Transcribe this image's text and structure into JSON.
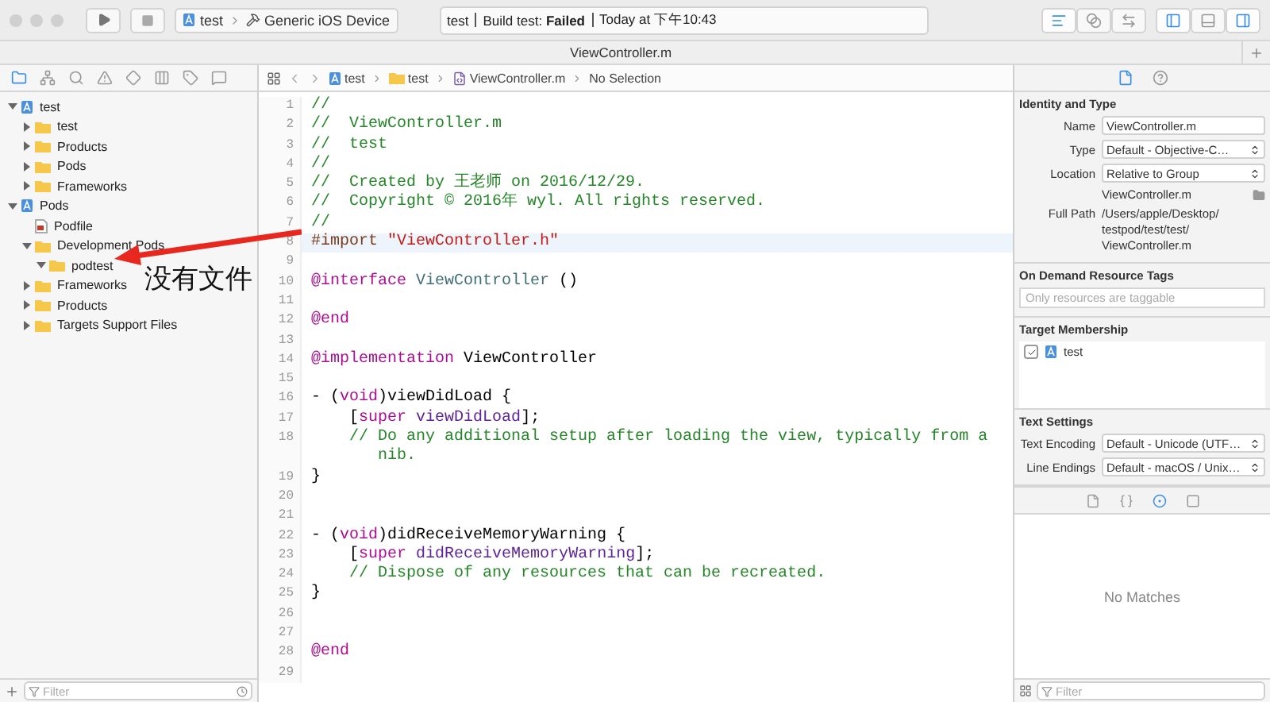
{
  "toolbar": {
    "scheme": {
      "project": "test",
      "device": "Generic iOS Device"
    },
    "status": {
      "project": "test",
      "message": "Build test: **Failed**",
      "time": "Today at 下午10:43"
    },
    "editor_modes": [
      {
        "kind": "standard",
        "selected": true
      },
      {
        "kind": "assistant",
        "selected": false
      },
      {
        "kind": "version",
        "selected": false
      }
    ],
    "panels": [
      {
        "kind": "left",
        "on": true
      },
      {
        "kind": "bottom",
        "on": false
      },
      {
        "kind": "right",
        "on": true
      }
    ]
  },
  "tab_bar": {
    "title": "ViewController.m"
  },
  "navigator": {
    "tabs": [
      {
        "kind": "project",
        "selected": true
      },
      {
        "kind": "symbol",
        "selected": false
      },
      {
        "kind": "find",
        "selected": false
      },
      {
        "kind": "issue",
        "selected": false
      },
      {
        "kind": "test",
        "selected": false
      },
      {
        "kind": "debug",
        "selected": false
      },
      {
        "kind": "breakpoint",
        "selected": false
      },
      {
        "kind": "report",
        "selected": false
      }
    ],
    "tree": [
      {
        "label": "test",
        "kind": "project",
        "expanded": true,
        "children": [
          {
            "label": "test",
            "kind": "folder",
            "expanded": false
          },
          {
            "label": "Products",
            "kind": "folder",
            "expanded": false
          },
          {
            "label": "Pods",
            "kind": "folder",
            "expanded": false
          },
          {
            "label": "Frameworks",
            "kind": "folder",
            "expanded": false
          }
        ]
      },
      {
        "label": "Pods",
        "kind": "project",
        "expanded": true,
        "children": [
          {
            "label": "Podfile",
            "kind": "file"
          },
          {
            "label": "Development Pods",
            "kind": "folder",
            "expanded": true,
            "children": [
              {
                "label": "podtest",
                "kind": "folder",
                "expanded": true
              }
            ]
          },
          {
            "label": "Frameworks",
            "kind": "folder",
            "expanded": false
          },
          {
            "label": "Products",
            "kind": "folder",
            "expanded": false
          },
          {
            "label": "Targets Support Files",
            "kind": "folder",
            "expanded": false
          }
        ]
      }
    ],
    "filter": {
      "placeholder": "Filter"
    }
  },
  "editor": {
    "jump_bar": [
      {
        "kind": "project",
        "label": "test"
      },
      {
        "kind": "folder",
        "label": "test"
      },
      {
        "kind": "file",
        "label": "ViewController.m"
      },
      {
        "kind": "text",
        "label": "No Selection"
      }
    ],
    "lines": [
      {
        "number": "1",
        "current": false,
        "tokens": [
          {
            "kind": "comment",
            "text": "//"
          }
        ]
      },
      {
        "number": "2",
        "current": false,
        "tokens": [
          {
            "kind": "comment",
            "text": "//  ViewController.m"
          }
        ]
      },
      {
        "number": "3",
        "current": false,
        "tokens": [
          {
            "kind": "comment",
            "text": "//  test"
          }
        ]
      },
      {
        "number": "4",
        "current": false,
        "tokens": [
          {
            "kind": "comment",
            "text": "//"
          }
        ]
      },
      {
        "number": "5",
        "current": false,
        "tokens": [
          {
            "kind": "comment",
            "text": "//  Created by 王老师 on 2016/12/29."
          }
        ]
      },
      {
        "number": "6",
        "current": false,
        "tokens": [
          {
            "kind": "comment",
            "text": "//  Copyright © 2016年 wyl. All rights reserved."
          }
        ]
      },
      {
        "number": "7",
        "current": false,
        "tokens": [
          {
            "kind": "comment",
            "text": "//"
          }
        ]
      },
      {
        "number": "8",
        "current": true,
        "tokens": [
          {
            "kind": "directive",
            "text": "#import "
          },
          {
            "kind": "string",
            "text": "\"ViewController.h\""
          }
        ]
      },
      {
        "number": "9",
        "current": false
      },
      {
        "number": "10",
        "current": false,
        "tokens": [
          {
            "kind": "keyword",
            "text": "@interface "
          },
          {
            "kind": "class",
            "text": "ViewController"
          },
          {
            "kind": "plain",
            "text": " ()"
          }
        ]
      },
      {
        "number": "11",
        "current": false
      },
      {
        "number": "12",
        "current": false,
        "tokens": [
          {
            "kind": "keyword",
            "text": "@end"
          }
        ]
      },
      {
        "number": "13",
        "current": false
      },
      {
        "number": "14",
        "current": false,
        "tokens": [
          {
            "kind": "keyword",
            "text": "@implementation"
          },
          {
            "kind": "plain",
            "text": " ViewController"
          }
        ]
      },
      {
        "number": "15",
        "current": false
      },
      {
        "number": "16",
        "current": false,
        "tokens": [
          {
            "kind": "plain",
            "text": "- ("
          },
          {
            "kind": "keyword",
            "text": "void"
          },
          {
            "kind": "plain",
            "text": ")viewDidLoad {"
          }
        ]
      },
      {
        "number": "17",
        "current": false,
        "tokens": [
          {
            "kind": "plain",
            "text": "    ["
          },
          {
            "kind": "keyword",
            "text": "super "
          },
          {
            "kind": "method",
            "text": "viewDidLoad"
          },
          {
            "kind": "plain",
            "text": "];"
          }
        ]
      },
      {
        "number": "18",
        "current": false,
        "tokens": [
          {
            "kind": "comment",
            "text": "    // Do any additional setup after loading the view, typically from a nib."
          }
        ]
      },
      {
        "number": "19",
        "current": false,
        "tokens": [
          {
            "kind": "plain",
            "text": "}"
          }
        ]
      },
      {
        "number": "20",
        "current": false
      },
      {
        "number": "21",
        "current": false
      },
      {
        "number": "22",
        "current": false,
        "tokens": [
          {
            "kind": "plain",
            "text": "- ("
          },
          {
            "kind": "keyword",
            "text": "void"
          },
          {
            "kind": "plain",
            "text": ")didReceiveMemoryWarning {"
          }
        ]
      },
      {
        "number": "23",
        "current": false,
        "tokens": [
          {
            "kind": "plain",
            "text": "    ["
          },
          {
            "kind": "keyword",
            "text": "super "
          },
          {
            "kind": "method",
            "text": "didReceiveMemoryWarning"
          },
          {
            "kind": "plain",
            "text": "];"
          }
        ]
      },
      {
        "number": "24",
        "current": false,
        "tokens": [
          {
            "kind": "comment",
            "text": "    // Dispose of any resources that can be recreated."
          }
        ]
      },
      {
        "number": "25",
        "current": false,
        "tokens": [
          {
            "kind": "plain",
            "text": "}"
          }
        ]
      },
      {
        "number": "26",
        "current": false
      },
      {
        "number": "27",
        "current": false
      },
      {
        "number": "28",
        "current": false,
        "tokens": [
          {
            "kind": "keyword",
            "text": "@end"
          }
        ]
      },
      {
        "number": "29",
        "current": false
      }
    ]
  },
  "annotation": {
    "text": "没有文件"
  },
  "inspector": {
    "tabs": [
      {
        "kind": "file",
        "selected": true
      },
      {
        "kind": "help",
        "selected": false
      }
    ],
    "identity": {
      "title": "Identity and Type",
      "rows": [
        {
          "label": "Name",
          "value": "ViewController.m",
          "kind": "text"
        },
        {
          "label": "Type",
          "value": "Default - Objective-C…",
          "kind": "popup"
        },
        {
          "label": "Location",
          "value": "Relative to Group",
          "kind": "popup"
        }
      ],
      "location_file": "ViewController.m",
      "full_path": {
        "label": "Full Path",
        "lines": [
          "/Users/apple/Desktop/",
          "testpod/test/test/",
          "ViewController.m"
        ]
      }
    },
    "on_demand": {
      "title": "On Demand Resource Tags",
      "placeholder": "Only resources are taggable"
    },
    "target_membership": {
      "title": "Target Membership",
      "targets": [
        {
          "name": "test",
          "checked": true
        }
      ]
    },
    "text_settings": {
      "title": "Text Settings",
      "rows": [
        {
          "label": "Text Encoding",
          "value": "Default - Unicode (UTF…"
        },
        {
          "label": "Line Endings",
          "value": "Default - macOS / Unix…"
        }
      ]
    }
  },
  "library": {
    "tabs": [
      {
        "kind": "file",
        "selected": false
      },
      {
        "kind": "code",
        "selected": false
      },
      {
        "kind": "object",
        "selected": true
      },
      {
        "kind": "media",
        "selected": false
      }
    ],
    "empty": "No Matches",
    "filter": {
      "placeholder": "Filter"
    }
  }
}
